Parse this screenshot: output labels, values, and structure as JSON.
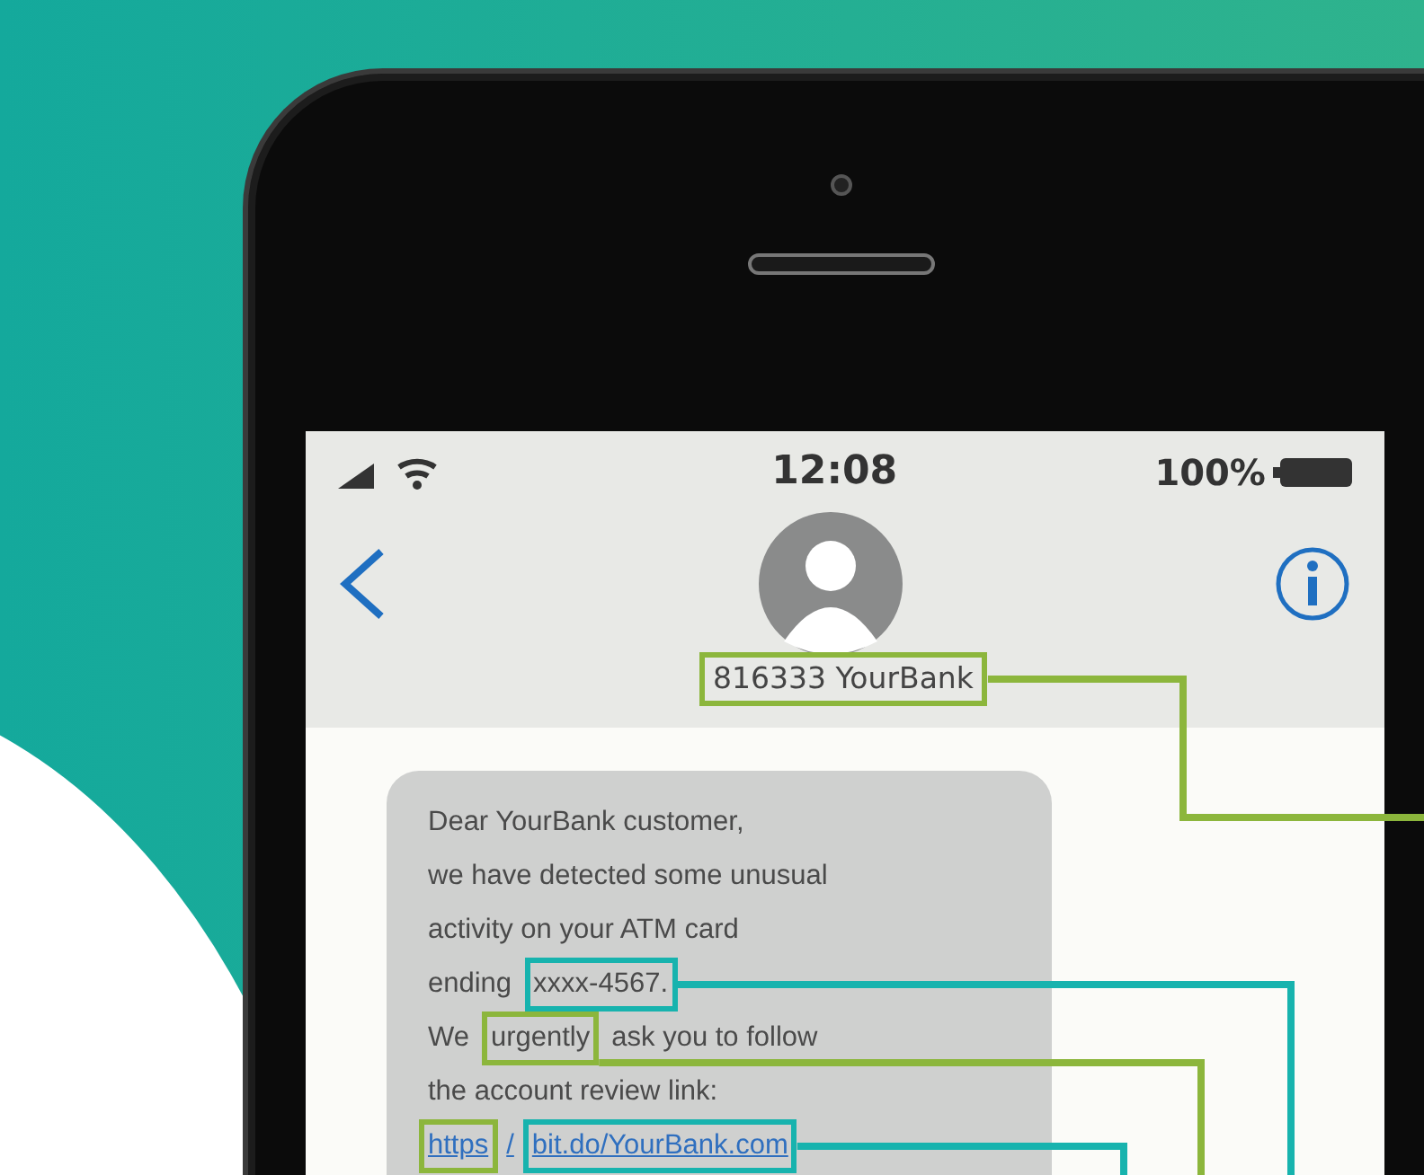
{
  "status_bar": {
    "time": "12:08",
    "battery": "100%"
  },
  "contact": {
    "name": "816333 YourBank",
    "boxed": true,
    "color": "#8cb63c",
    "callout": true
  },
  "message": {
    "lines": [
      [
        {
          "text": "Dear YourBank customer,",
          "boxed": false,
          "link": false,
          "callout": false
        }
      ],
      [
        {
          "text": "we have detected some unusual",
          "boxed": false,
          "link": false,
          "callout": false
        }
      ],
      [
        {
          "text": "activity on your ATM card",
          "boxed": false,
          "link": false,
          "callout": false
        }
      ],
      [
        {
          "text": "ending",
          "boxed": false,
          "link": false,
          "callout": false
        },
        {
          "text": "xxxx-4567.",
          "boxed": true,
          "color": "#17b3ae",
          "link": false,
          "callout": true
        }
      ],
      [
        {
          "text": "We",
          "boxed": false,
          "link": false,
          "callout": false
        },
        {
          "text": "urgently",
          "boxed": true,
          "color": "#8cb63c",
          "link": false,
          "callout": true
        },
        {
          "text": "ask you to follow",
          "boxed": false,
          "link": false,
          "callout": false
        }
      ],
      [
        {
          "text": "the account review link:",
          "boxed": false,
          "link": false,
          "callout": false
        }
      ],
      [
        {
          "text": "https",
          "boxed": true,
          "color": "#8cb63c",
          "link": true,
          "callout": false
        },
        {
          "text": "/",
          "boxed": false,
          "link": true,
          "callout": false
        },
        {
          "text": "bit.do/YourBank.com",
          "boxed": true,
          "color": "#17b3ae",
          "link": true,
          "callout": true
        }
      ]
    ]
  }
}
